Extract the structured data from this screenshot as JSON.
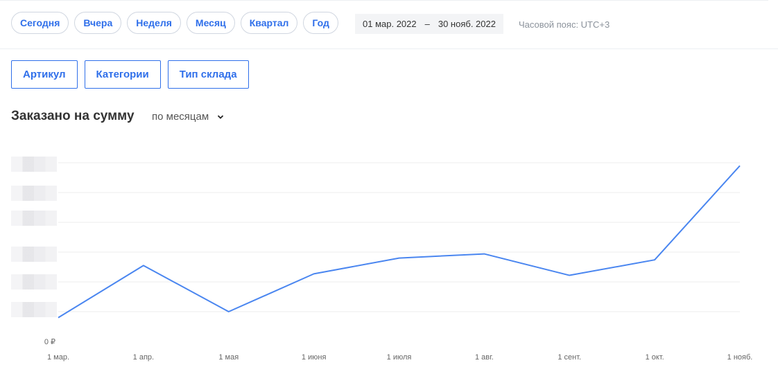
{
  "filters": {
    "periods": [
      "Сегодня",
      "Вчера",
      "Неделя",
      "Месяц",
      "Квартал",
      "Год"
    ],
    "date_from": "01 мар. 2022",
    "date_sep": "–",
    "date_to": "30 нояб. 2022",
    "timezone": "Часовой пояс: UTC+3",
    "groupings": [
      "Артикул",
      "Категории",
      "Тип склада"
    ]
  },
  "chart_header": {
    "title": "Заказано на сумму",
    "period_select": "по месяцам"
  },
  "colors": {
    "accent": "#2f6fea",
    "line": "#4a86f0",
    "grid": "#eeeeee"
  },
  "chart_data": {
    "type": "line",
    "title": "Заказано на сумму",
    "categories": [
      "1 мар.",
      "1 апр.",
      "1 мая",
      "1 июня",
      "1 июля",
      "1 авг.",
      "1 сент.",
      "1 окт.",
      "1 нояб."
    ],
    "series": [
      {
        "values": [
          0.8,
          2.55,
          1.0,
          2.27,
          2.8,
          2.94,
          2.22,
          2.74,
          5.9
        ]
      }
    ],
    "ylim": [
      0,
      6
    ],
    "y_zero_label": "0 ₽",
    "grid": true
  }
}
